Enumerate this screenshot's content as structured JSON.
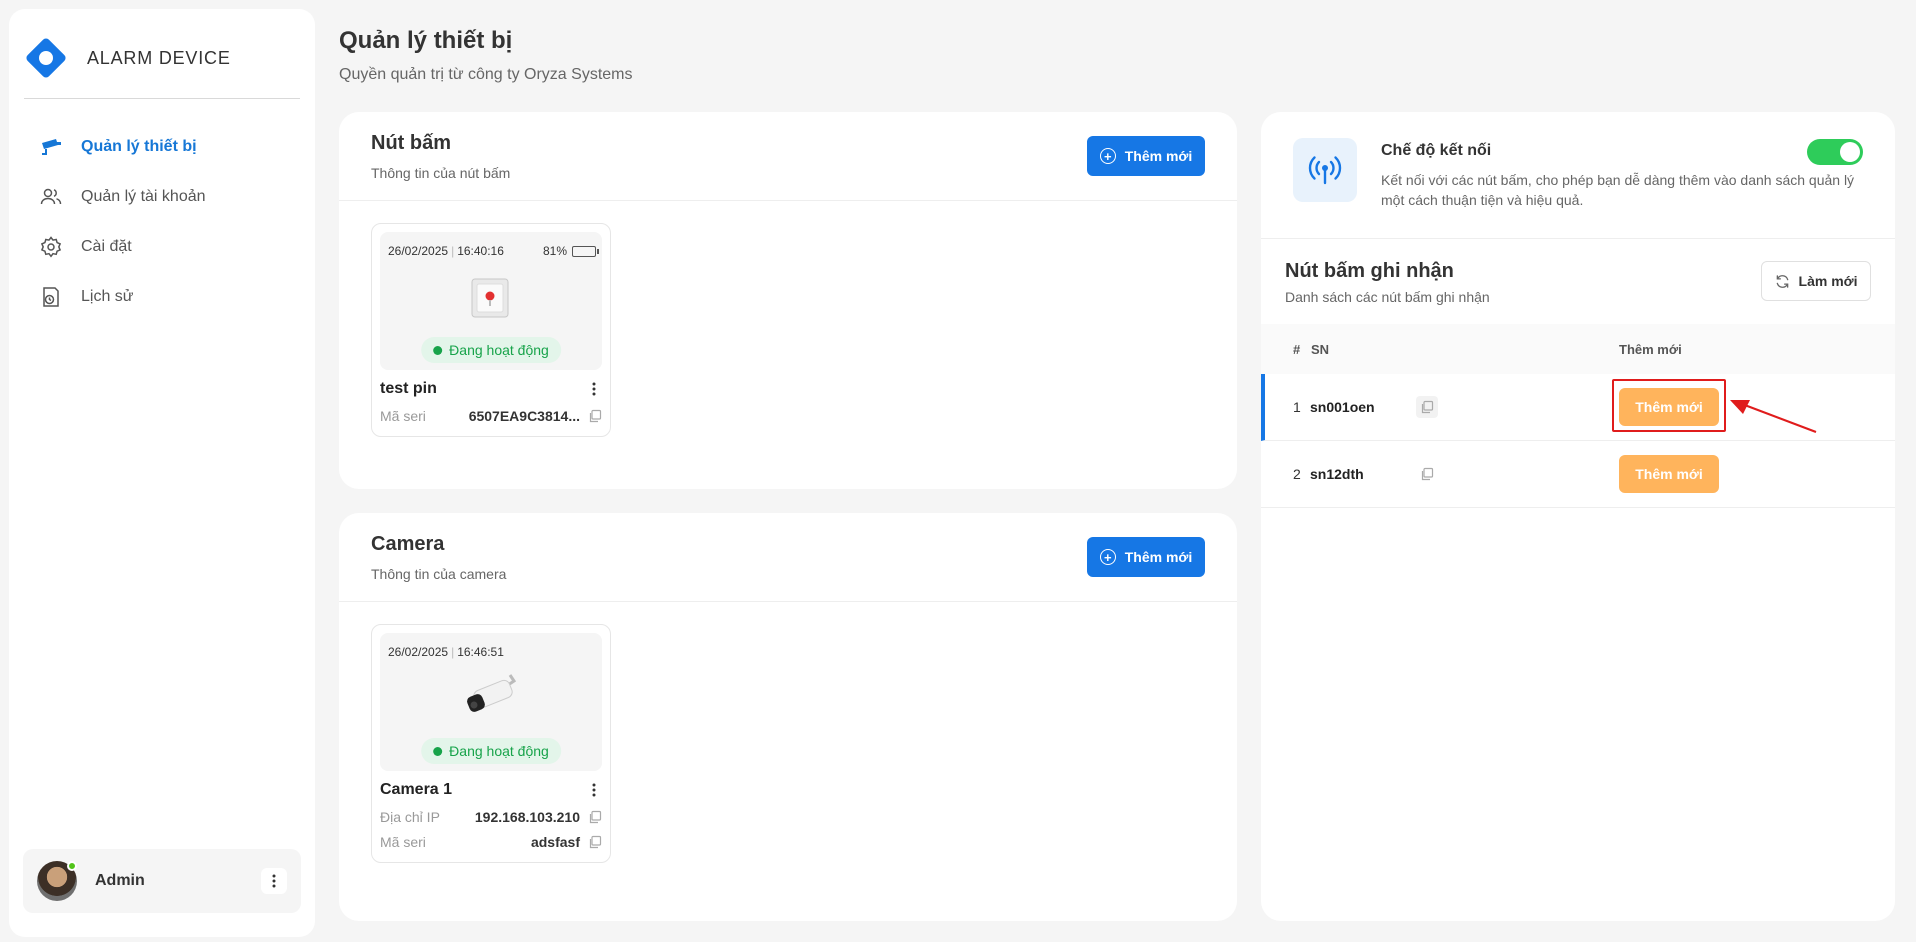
{
  "brand": {
    "name": "ALARM DEVICE"
  },
  "sidebar": {
    "items": [
      {
        "label": "Quản lý thiết bị",
        "icon": "cctv-camera-icon",
        "active": true
      },
      {
        "label": "Quản lý tài khoản",
        "icon": "users-icon",
        "active": false
      },
      {
        "label": "Cài đặt",
        "icon": "gear-icon",
        "active": false
      },
      {
        "label": "Lịch sử",
        "icon": "history-icon",
        "active": false
      }
    ],
    "user": {
      "name": "Admin",
      "online": true
    }
  },
  "header": {
    "title": "Quản lý thiết bị",
    "subtitle": "Quyền quản trị từ công ty Oryza Systems"
  },
  "buttons_card": {
    "title": "Nút bấm",
    "subtitle": "Thông tin của nút bấm",
    "add_label": "Thêm mới",
    "device": {
      "date": "26/02/2025",
      "time": "16:40:16",
      "battery": "81%",
      "battery_level": 0.81,
      "status": "Đang hoạt động",
      "name": "test pin",
      "serial_label": "Mã seri",
      "serial_value": "6507EA9C3814..."
    }
  },
  "camera_card": {
    "title": "Camera",
    "subtitle": "Thông tin của camera",
    "add_label": "Thêm mới",
    "device": {
      "date": "26/02/2025",
      "time": "16:46:51",
      "status": "Đang hoạt động",
      "name": "Camera 1",
      "ip_label": "Địa chỉ IP",
      "ip_value": "192.168.103.210",
      "serial_label": "Mã seri",
      "serial_value": "adsfasf"
    }
  },
  "connection": {
    "title": "Chế độ kết nối",
    "description": "Kết nối với các nút bấm, cho phép bạn dễ dàng thêm vào danh sách quản lý một cách thuận tiện và hiệu quả.",
    "enabled": true
  },
  "recorded": {
    "title": "Nút bấm ghi nhận",
    "subtitle": "Danh sách các nút bấm ghi nhận",
    "refresh_label": "Làm mới",
    "columns": {
      "num": "#",
      "sn": "SN",
      "action": "Thêm mới"
    },
    "rows": [
      {
        "num": "1",
        "sn": "sn001oen",
        "action": "Thêm mới"
      },
      {
        "num": "2",
        "sn": "sn12dth",
        "action": "Thêm mới"
      }
    ]
  },
  "colors": {
    "primary": "#1677e5",
    "accent_orange": "#ffb45c",
    "success": "#17a34a",
    "highlight": "#e01c1c"
  }
}
